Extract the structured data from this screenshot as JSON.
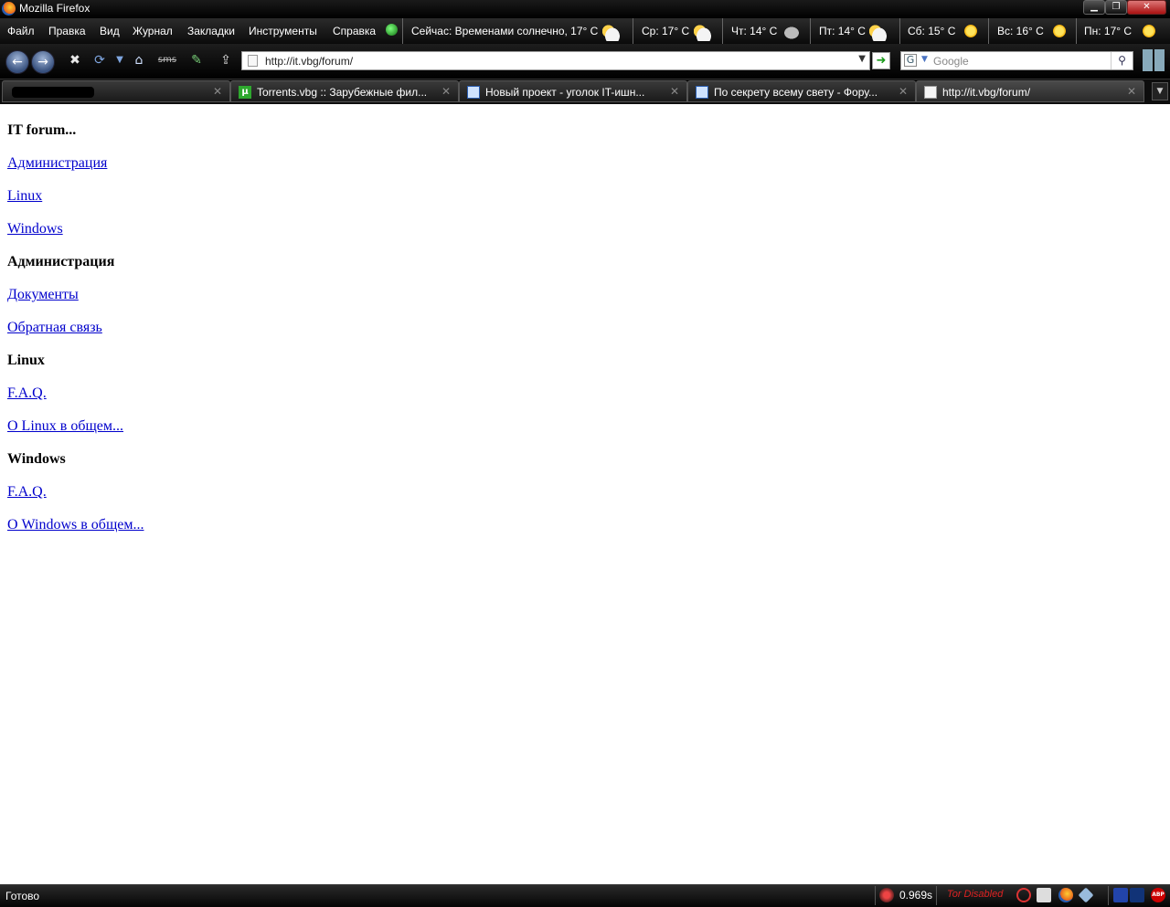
{
  "window": {
    "title": "Mozilla Firefox"
  },
  "menu": [
    "Файл",
    "Правка",
    "Вид",
    "Журнал",
    "Закладки",
    "Инструменты",
    "Справка"
  ],
  "weather": {
    "now": "Сейчас: Временами солнечно, 17° C",
    "days": [
      {
        "label": "Ср: 17° C",
        "icon": "partly-sunny-icon"
      },
      {
        "label": "Чт: 14° C",
        "icon": "rain-icon"
      },
      {
        "label": "Пт: 14° C",
        "icon": "partly-sunny-icon"
      },
      {
        "label": "Сб: 15° C",
        "icon": "sun-icon"
      },
      {
        "label": "Вс: 16° C",
        "icon": "sun-icon"
      },
      {
        "label": "Пн: 17° C",
        "icon": "sun-icon"
      }
    ]
  },
  "toolbar": {
    "sms_label": "sms"
  },
  "address": {
    "url": "http://it.vbg/forum/"
  },
  "search": {
    "placeholder": "Google",
    "engine_letter": "G"
  },
  "tabs": [
    {
      "label": "",
      "redacted": true
    },
    {
      "label": "Torrents.vbg :: Зарубежные фил...",
      "icon": "torrent-icon",
      "icon_letter": "µ"
    },
    {
      "label": "Новый проект - уголок IT-ишн...",
      "icon": "mail-icon"
    },
    {
      "label": "По секрету всему свету - Фору...",
      "icon": "mail-icon"
    },
    {
      "label": "http://it.vbg/forum/",
      "icon": "page-icon",
      "active": true
    }
  ],
  "content": {
    "items": [
      {
        "text": "IT forum...",
        "type": "heading"
      },
      {
        "text": "Администрация",
        "type": "link"
      },
      {
        "text": "Linux",
        "type": "link"
      },
      {
        "text": "Windows",
        "type": "link"
      },
      {
        "text": "Администрация",
        "type": "heading"
      },
      {
        "text": "Документы",
        "type": "link"
      },
      {
        "text": "Обратная связь",
        "type": "link"
      },
      {
        "text": "Linux",
        "type": "heading"
      },
      {
        "text": "F.A.Q.",
        "type": "link"
      },
      {
        "text": "О Linux в общем...",
        "type": "link"
      },
      {
        "text": "Windows",
        "type": "heading"
      },
      {
        "text": "F.A.Q.",
        "type": "link"
      },
      {
        "text": "О Windows в общем...",
        "type": "link"
      }
    ]
  },
  "status": {
    "text": "Готово",
    "timer": "0.969s",
    "tor": "Tor Disabled",
    "abp_label": "ABP"
  },
  "colors": {
    "link": "#0000cc",
    "tor_disabled": "#dd2222",
    "chrome": "#000000"
  }
}
